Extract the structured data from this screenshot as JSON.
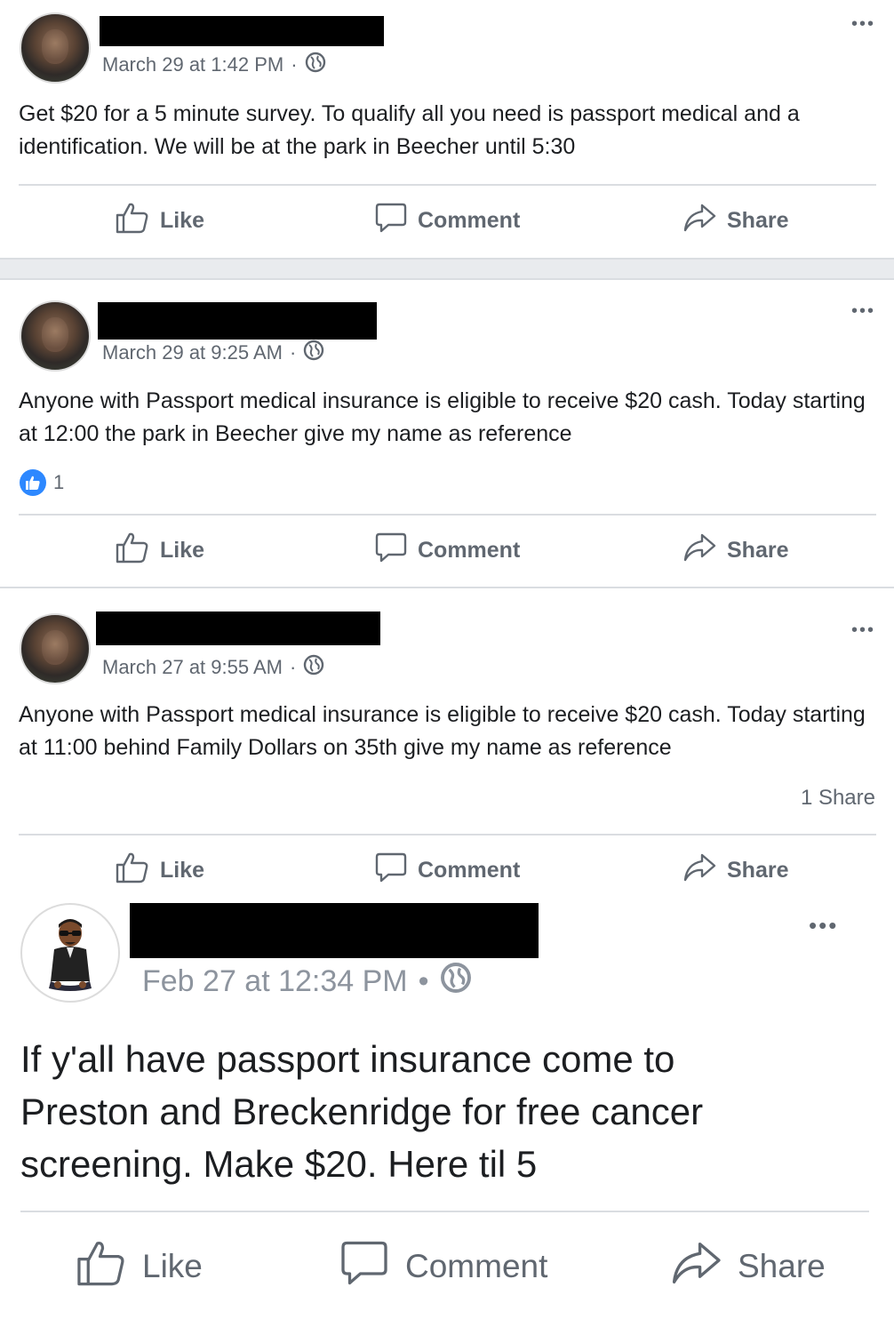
{
  "posts": [
    {
      "timestamp": "March 29 at 1:42 PM",
      "separator": "·",
      "body": "Get $20 for a 5 minute survey. To qualify all you need is passport medical and a identification. We will be at the park in Beecher until 5:30",
      "more": "•••",
      "actions": {
        "like": "Like",
        "comment": "Comment",
        "share": "Share"
      }
    },
    {
      "timestamp": "March 29 at 9:25 AM",
      "separator": "·",
      "body": "Anyone with Passport medical insurance is eligible to receive $20 cash. Today starting at 12:00 the park in Beecher give my name as reference",
      "reaction_count": "1",
      "more": "•••",
      "actions": {
        "like": "Like",
        "comment": "Comment",
        "share": "Share"
      }
    },
    {
      "timestamp": "March 27 at 9:55 AM",
      "separator": "·",
      "body": "Anyone with Passport medical insurance is eligible to receive $20 cash. Today starting at 11:00 behind Family Dollars on 35th give my name as reference",
      "share_count": "1 Share",
      "more": "•••",
      "actions": {
        "like": "Like",
        "comment": "Comment",
        "share": "Share"
      }
    },
    {
      "timestamp": "Feb 27 at 12:34 PM",
      "separator": "•",
      "body": "If y'all have passport insurance come to Preston and Breckenridge for free cancer screening. Make $20. Here til 5",
      "more": "•••",
      "actions": {
        "like": "Like",
        "comment": "Comment",
        "share": "Share"
      }
    }
  ],
  "icons": {
    "like": "thumbs-up-outline-icon",
    "comment": "speech-bubble-icon",
    "share": "share-arrow-icon",
    "globe": "globe-icon",
    "more": "more-options-icon"
  },
  "colors": {
    "meta": "#606770",
    "divider": "#dadde1",
    "like_badge": "#2d88ff",
    "feed_band": "#e9ebee"
  }
}
